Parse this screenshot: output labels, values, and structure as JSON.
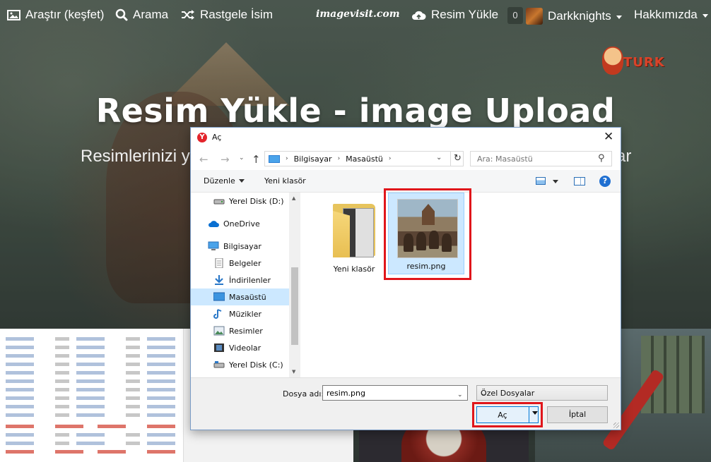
{
  "nav": {
    "explore": "Araştır (keşfet)",
    "search": "Arama",
    "random": "Rastgele İsim",
    "brand": "imagevisit.com",
    "upload": "Resim Yükle",
    "badge_count": "0",
    "user": "Darkknights",
    "about": "Hakkımızda"
  },
  "hero": {
    "title": "Resim Yükle - image Upload",
    "subtitle_left": "Resimlerinizi yü",
    "subtitle_right": "ar"
  },
  "dialog": {
    "title": "Aç",
    "app_icon_letter": "Y",
    "address": {
      "crumbs": [
        "Bilgisayar",
        "Masaüstü"
      ]
    },
    "search_placeholder": "Ara: Masaüstü",
    "toolbar": {
      "organize": "Düzenle",
      "new_folder": "Yeni klasör"
    },
    "nav_items": [
      {
        "label": "Yerel Disk (D:)",
        "icon": "drive-icon"
      },
      {
        "label": "OneDrive",
        "icon": "cloud-icon"
      },
      {
        "label": "Bilgisayar",
        "icon": "computer-icon"
      },
      {
        "label": "Belgeler",
        "icon": "document-icon"
      },
      {
        "label": "İndirilenler",
        "icon": "download-icon"
      },
      {
        "label": "Masaüstü",
        "icon": "desktop-icon",
        "selected": true
      },
      {
        "label": "Müzikler",
        "icon": "music-icon"
      },
      {
        "label": "Resimler",
        "icon": "pictures-icon"
      },
      {
        "label": "Videolar",
        "icon": "video-icon"
      },
      {
        "label": "Yerel Disk (C:)",
        "icon": "drive-icon"
      }
    ],
    "files": [
      {
        "name": "Yeni klasör",
        "type": "folder"
      },
      {
        "name": "resim.png",
        "type": "image",
        "selected": true
      }
    ],
    "filename_label": "Dosya adı:",
    "filename_value": "resim.png",
    "filter": "Özel Dosyalar",
    "open_label": "Aç",
    "cancel_label": "İptal"
  },
  "colors": {
    "highlight_red": "#e0161b",
    "selection_blue": "#cce8ff",
    "accent_blue": "#0078d7"
  }
}
